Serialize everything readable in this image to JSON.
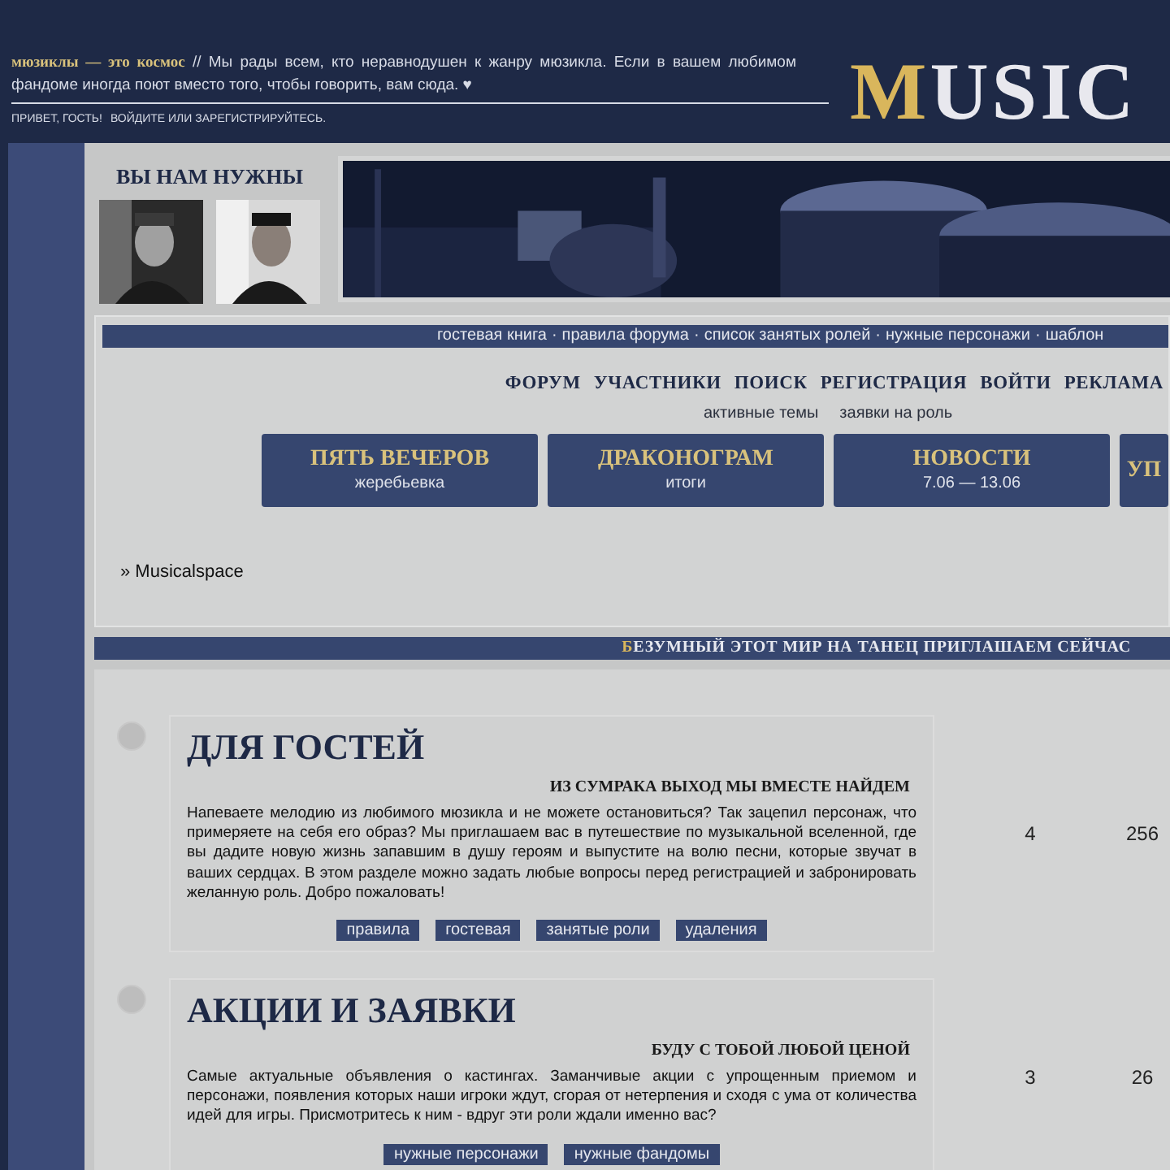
{
  "header": {
    "tagline_title": "мюзиклы — это космос",
    "tagline_text": "// Мы рады всем, кто неравнодушен к жанру мюзикла. Если в вашем любимом фандоме иногда поют вместо того, чтобы говорить, вам сюда. ♥",
    "greeting": "ПРИВЕТ, ГОСТЬ!",
    "login_link": "ВОЙДИТЕ ИЛИ ЗАРЕГИСТРИРУЙТЕСЬ.",
    "logo_initial": "M",
    "logo_rest": "USIC"
  },
  "wanted": {
    "title": "ВЫ НАМ НУЖНЫ"
  },
  "nav_separator": "·",
  "nav_links": [
    "гостевая книга",
    "правила форума",
    "список занятых ролей",
    "нужные персонажи",
    "шаблон"
  ],
  "menu": [
    "ФОРУМ",
    "УЧАСТНИКИ",
    "ПОИСК",
    "РЕГИСТРАЦИЯ",
    "ВОЙТИ",
    "РЕКЛАМА"
  ],
  "submenu": [
    "активные темы",
    "заявки на роль"
  ],
  "feature_buttons": [
    {
      "title": "ПЯТЬ ВЕЧЕРОВ",
      "subtitle": "жеребьевка"
    },
    {
      "title": "ДРАКОНОГРАМ",
      "subtitle": "итоги"
    },
    {
      "title": "НОВОСТИ",
      "subtitle": "7.06 — 13.06"
    },
    {
      "title": "УП"
    }
  ],
  "breadcrumb": "» Musicalspace",
  "section_title": {
    "initial": "Б",
    "rest": "ЕЗУМНЫЙ ЭТОТ МИР НА ТАНЕЦ ПРИГЛАШАЕМ СЕЙЧАС"
  },
  "forums": [
    {
      "title": "ДЛЯ ГОСТЕЙ",
      "subtitle": "ИЗ СУМРАКА ВЫХОД МЫ ВМЕСТЕ НАЙДЕМ",
      "description": "Напеваете мелодию из любимого мюзикла и не можете остановиться? Так зацепил персонаж, что примеряете на себя его образ? Мы приглашаем вас в путешествие по музыкальной вселенной, где вы дадите новую жизнь запавшим в душу героям и выпустите на волю песни, которые звучат в ваших сердцах. В этом разделе можно задать любые вопросы перед регистрацией и забронировать желанную роль. Добро пожаловать!",
      "tags": [
        "правила",
        "гостевая",
        "занятые роли",
        "удаления"
      ],
      "topics": "4",
      "posts": "256"
    },
    {
      "title": "АКЦИИ И ЗАЯВКИ",
      "subtitle": "БУДУ С ТОБОЙ ЛЮБОЙ ЦЕНОЙ",
      "description": "Самые актуальные объявления о кастингах. Заманчивые акции с упрощенным приемом и персонажи, появления которых наши игроки ждут, сгорая от нетерпения и сходя с ума от количества идей для игры. Присмотритесь к ним - вдруг эти роли ждали именно вас?",
      "tags": [
        "нужные персонажи",
        "нужные фандомы"
      ],
      "topics": "3",
      "posts": "26"
    }
  ]
}
